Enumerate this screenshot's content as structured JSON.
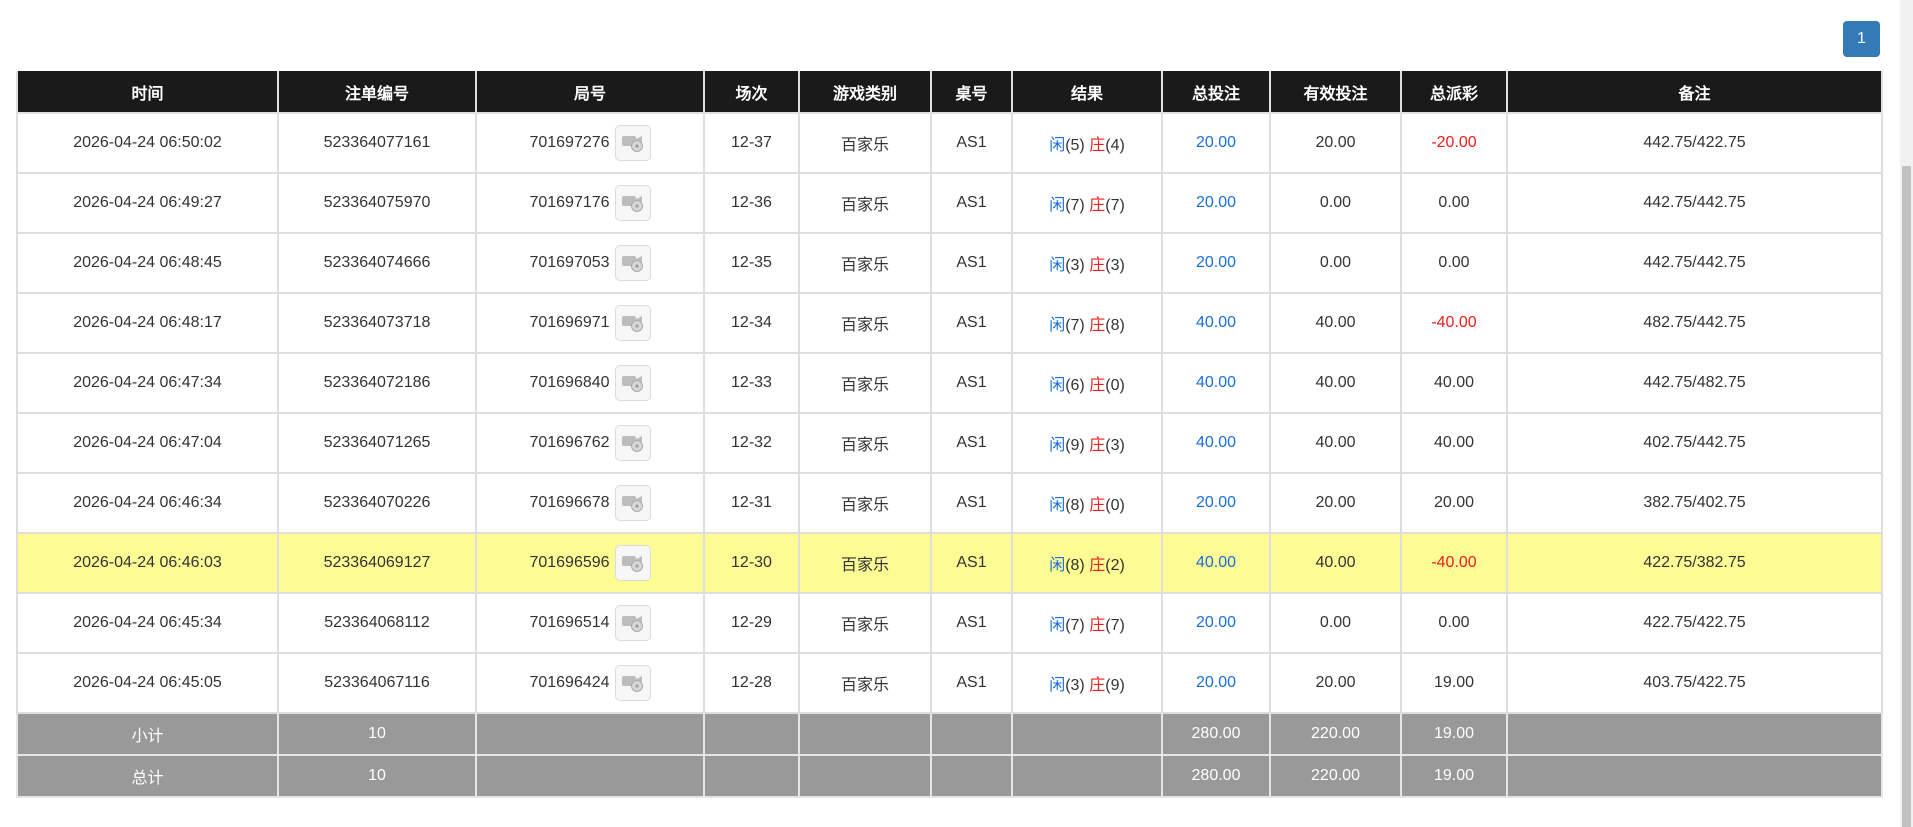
{
  "pagination": {
    "current_page": "1"
  },
  "table": {
    "headers": [
      "时间",
      "注单编号",
      "局号",
      "场次",
      "游戏类别",
      "桌号",
      "结果",
      "总投注",
      "有效投注",
      "总派彩",
      "备注"
    ],
    "rows": [
      {
        "time": "2026-04-24 06:50:02",
        "bet_id": "523364077161",
        "round": "701697276",
        "session": "12-37",
        "game": "百家乐",
        "table_no": "AS1",
        "player_label": "闲",
        "player_score": "(5)",
        "banker_label": "庄",
        "banker_score": "(4)",
        "total_bet": "20.00",
        "valid_bet": "20.00",
        "payout": "-20.00",
        "payout_neg": true,
        "note": "442.75/422.75"
      },
      {
        "time": "2026-04-24 06:49:27",
        "bet_id": "523364075970",
        "round": "701697176",
        "session": "12-36",
        "game": "百家乐",
        "table_no": "AS1",
        "player_label": "闲",
        "player_score": "(7)",
        "banker_label": "庄",
        "banker_score": "(7)",
        "total_bet": "20.00",
        "valid_bet": "0.00",
        "payout": "0.00",
        "payout_neg": false,
        "note": "442.75/442.75"
      },
      {
        "time": "2026-04-24 06:48:45",
        "bet_id": "523364074666",
        "round": "701697053",
        "session": "12-35",
        "game": "百家乐",
        "table_no": "AS1",
        "player_label": "闲",
        "player_score": "(3)",
        "banker_label": "庄",
        "banker_score": "(3)",
        "total_bet": "20.00",
        "valid_bet": "0.00",
        "payout": "0.00",
        "payout_neg": false,
        "note": "442.75/442.75"
      },
      {
        "time": "2026-04-24 06:48:17",
        "bet_id": "523364073718",
        "round": "701696971",
        "session": "12-34",
        "game": "百家乐",
        "table_no": "AS1",
        "player_label": "闲",
        "player_score": "(7)",
        "banker_label": "庄",
        "banker_score": "(8)",
        "total_bet": "40.00",
        "valid_bet": "40.00",
        "payout": "-40.00",
        "payout_neg": true,
        "note": "482.75/442.75"
      },
      {
        "time": "2026-04-24 06:47:34",
        "bet_id": "523364072186",
        "round": "701696840",
        "session": "12-33",
        "game": "百家乐",
        "table_no": "AS1",
        "player_label": "闲",
        "player_score": "(6)",
        "banker_label": "庄",
        "banker_score": "(0)",
        "total_bet": "40.00",
        "valid_bet": "40.00",
        "payout": "40.00",
        "payout_neg": false,
        "note": "442.75/482.75"
      },
      {
        "time": "2026-04-24 06:47:04",
        "bet_id": "523364071265",
        "round": "701696762",
        "session": "12-32",
        "game": "百家乐",
        "table_no": "AS1",
        "player_label": "闲",
        "player_score": "(9)",
        "banker_label": "庄",
        "banker_score": "(3)",
        "total_bet": "40.00",
        "valid_bet": "40.00",
        "payout": "40.00",
        "payout_neg": false,
        "note": "402.75/442.75"
      },
      {
        "time": "2026-04-24 06:46:34",
        "bet_id": "523364070226",
        "round": "701696678",
        "session": "12-31",
        "game": "百家乐",
        "table_no": "AS1",
        "player_label": "闲",
        "player_score": "(8)",
        "banker_label": "庄",
        "banker_score": "(0)",
        "total_bet": "20.00",
        "valid_bet": "20.00",
        "payout": "20.00",
        "payout_neg": false,
        "note": "382.75/402.75"
      },
      {
        "time": "2026-04-24 06:46:03",
        "bet_id": "523364069127",
        "round": "701696596",
        "session": "12-30",
        "game": "百家乐",
        "table_no": "AS1",
        "player_label": "闲",
        "player_score": "(8)",
        "banker_label": "庄",
        "banker_score": "(2)",
        "total_bet": "40.00",
        "valid_bet": "40.00",
        "payout": "-40.00",
        "payout_neg": true,
        "note": "422.75/382.75",
        "highlighted": true
      },
      {
        "time": "2026-04-24 06:45:34",
        "bet_id": "523364068112",
        "round": "701696514",
        "session": "12-29",
        "game": "百家乐",
        "table_no": "AS1",
        "player_label": "闲",
        "player_score": "(7)",
        "banker_label": "庄",
        "banker_score": "(7)",
        "total_bet": "20.00",
        "valid_bet": "0.00",
        "payout": "0.00",
        "payout_neg": false,
        "note": "422.75/422.75"
      },
      {
        "time": "2026-04-24 06:45:05",
        "bet_id": "523364067116",
        "round": "701696424",
        "session": "12-28",
        "game": "百家乐",
        "table_no": "AS1",
        "player_label": "闲",
        "player_score": "(3)",
        "banker_label": "庄",
        "banker_score": "(9)",
        "total_bet": "20.00",
        "valid_bet": "20.00",
        "payout": "19.00",
        "payout_neg": false,
        "note": "403.75/422.75"
      }
    ],
    "subtotal": {
      "label": "小计",
      "count": "10",
      "total_bet": "280.00",
      "valid_bet": "220.00",
      "payout": "19.00"
    },
    "grand_total": {
      "label": "总计",
      "count": "10",
      "total_bet": "280.00",
      "valid_bet": "220.00",
      "payout": "19.00"
    }
  },
  "colors": {
    "header_bg": "#1a1a1a",
    "player": "#1a6fe0",
    "banker": "#ee1c1c",
    "highlight": "#fdfb94",
    "sum_bg": "#999999",
    "page_button": "#337ab7"
  },
  "icons": {
    "replay": "video-replay-icon"
  }
}
